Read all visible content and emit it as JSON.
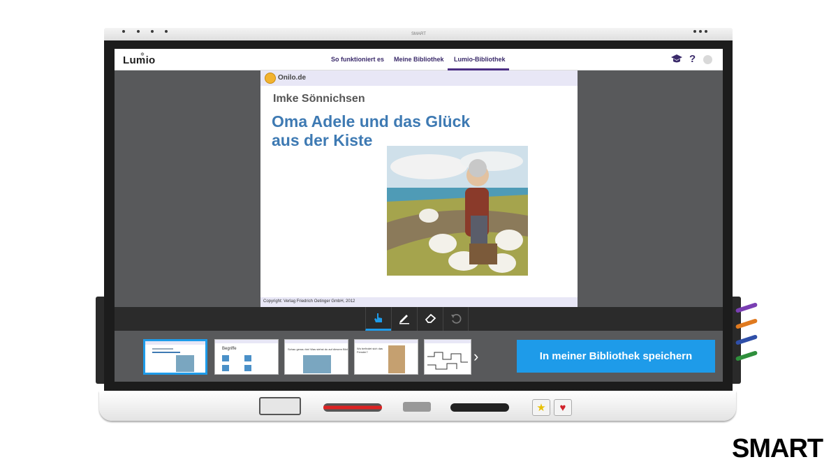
{
  "bezel": {
    "brand": "SMART"
  },
  "nav": {
    "logo": "Lumio",
    "tabs": [
      {
        "label": "So funktioniert es"
      },
      {
        "label": "Meine Bibliothek"
      },
      {
        "label": "Lumio-Bibliothek",
        "active": true
      }
    ],
    "icons": [
      "graduation-cap-icon",
      "help-icon",
      "avatar-icon"
    ]
  },
  "slide": {
    "brand": "Onilo.de",
    "author": "Imke Sönnichsen",
    "title": "Oma Adele und das Glück aus der Kiste",
    "copyright": "Copyright: Verlag Friedrich Oetinger GmbH, 2012"
  },
  "toolbar": {
    "tools": [
      "hand-pointer-icon",
      "pen-icon",
      "eraser-icon",
      "undo-icon"
    ],
    "active_tool": "hand-pointer-icon"
  },
  "thumbnails": {
    "count_visible": 5,
    "selected_index": 0,
    "t2_title": "Begriffe",
    "t3_text": "Schau genau hin! Was siehst du auf diesem Bild?",
    "t4_text": "Wo befindet sich das Fenster?"
  },
  "actions": {
    "save_label": "In meiner Bibliothek speichern"
  },
  "footer": {
    "logo": "SMART"
  },
  "colors": {
    "accent": "#1e9be9",
    "nav_text": "#3a2a6a",
    "title_blue": "#3e7ab3",
    "canvas_gray": "#58595b"
  }
}
